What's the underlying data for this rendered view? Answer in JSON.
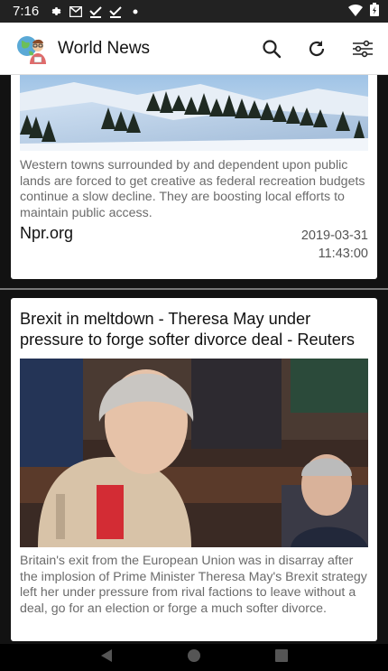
{
  "status_bar": {
    "time": "7:16",
    "icons": [
      "gear-icon",
      "gmail-icon",
      "download-done-icon",
      "download-done-icon",
      "dot-icon"
    ],
    "right_icons": [
      "wifi-icon",
      "battery-icon"
    ]
  },
  "app_bar": {
    "title": "World News",
    "actions": [
      "search-icon",
      "refresh-icon",
      "filter-settings-icon"
    ]
  },
  "articles": [
    {
      "description": "Western towns surrounded by and dependent upon public lands are forced to get creative as federal recreation budgets continue a slow decline. They are boosting local efforts to maintain public access.",
      "source": "Npr.org",
      "date": "2019-03-31",
      "time": "11:43:00",
      "image": "snowy-mountain-forest"
    },
    {
      "title": "Brexit in meltdown - Theresa May under pressure to forge softer divorce deal - Reuters",
      "description": "Britain's exit from the European Union was in disarray after the implosion of Prime Minister Theresa May's Brexit strategy left her under pressure from rival factions to leave without a deal, go for an election or forge a much softer divorce.",
      "image": "parliament-speaker-photo"
    }
  ],
  "nav_bar": {
    "buttons": [
      "back-icon",
      "home-icon",
      "recents-icon"
    ]
  },
  "colors": {
    "status_bar": "#222222",
    "feed_background": "#121212",
    "card": "#ffffff",
    "description_text": "#6b6b6b"
  }
}
